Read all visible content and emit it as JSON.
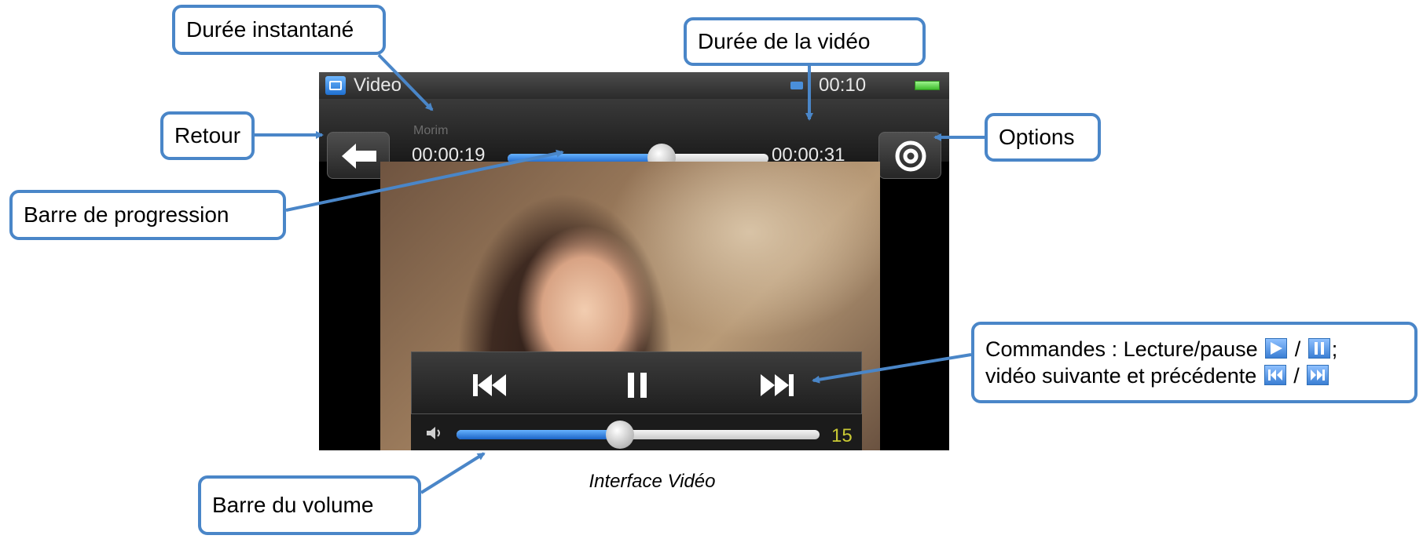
{
  "player": {
    "app_title": "Video",
    "clock": "00:10",
    "track_name": "Morim",
    "elapsed": "00:00:19",
    "total": "00:00:31",
    "progress_fraction": 0.59,
    "volume_value": "15",
    "volume_fraction": 0.45
  },
  "callouts": {
    "retour": "Retour",
    "duree_instantane": "Durée instantané",
    "duree_video": "Durée de la vidéo",
    "options": "Options",
    "barre_progression": "Barre de progression",
    "barre_volume": "Barre du volume",
    "commandes_line1_a": "Commandes : Lecture/pause",
    "commandes_line1_sep": "/",
    "commandes_line1_end": ";",
    "commandes_line2_a": "vidéo suivante et précédente",
    "commandes_line2_sep": "/"
  },
  "caption": "Interface Vidéo",
  "colors": {
    "callout_border": "#4a86c8",
    "progress_fill": "#1b63c6",
    "volume_text": "#c9c934"
  },
  "icons": [
    "app-video-icon",
    "usb-icon",
    "battery-icon",
    "back-arrow-icon",
    "gear-icon",
    "previous-icon",
    "pause-icon",
    "next-icon",
    "speaker-icon",
    "play-icon"
  ]
}
